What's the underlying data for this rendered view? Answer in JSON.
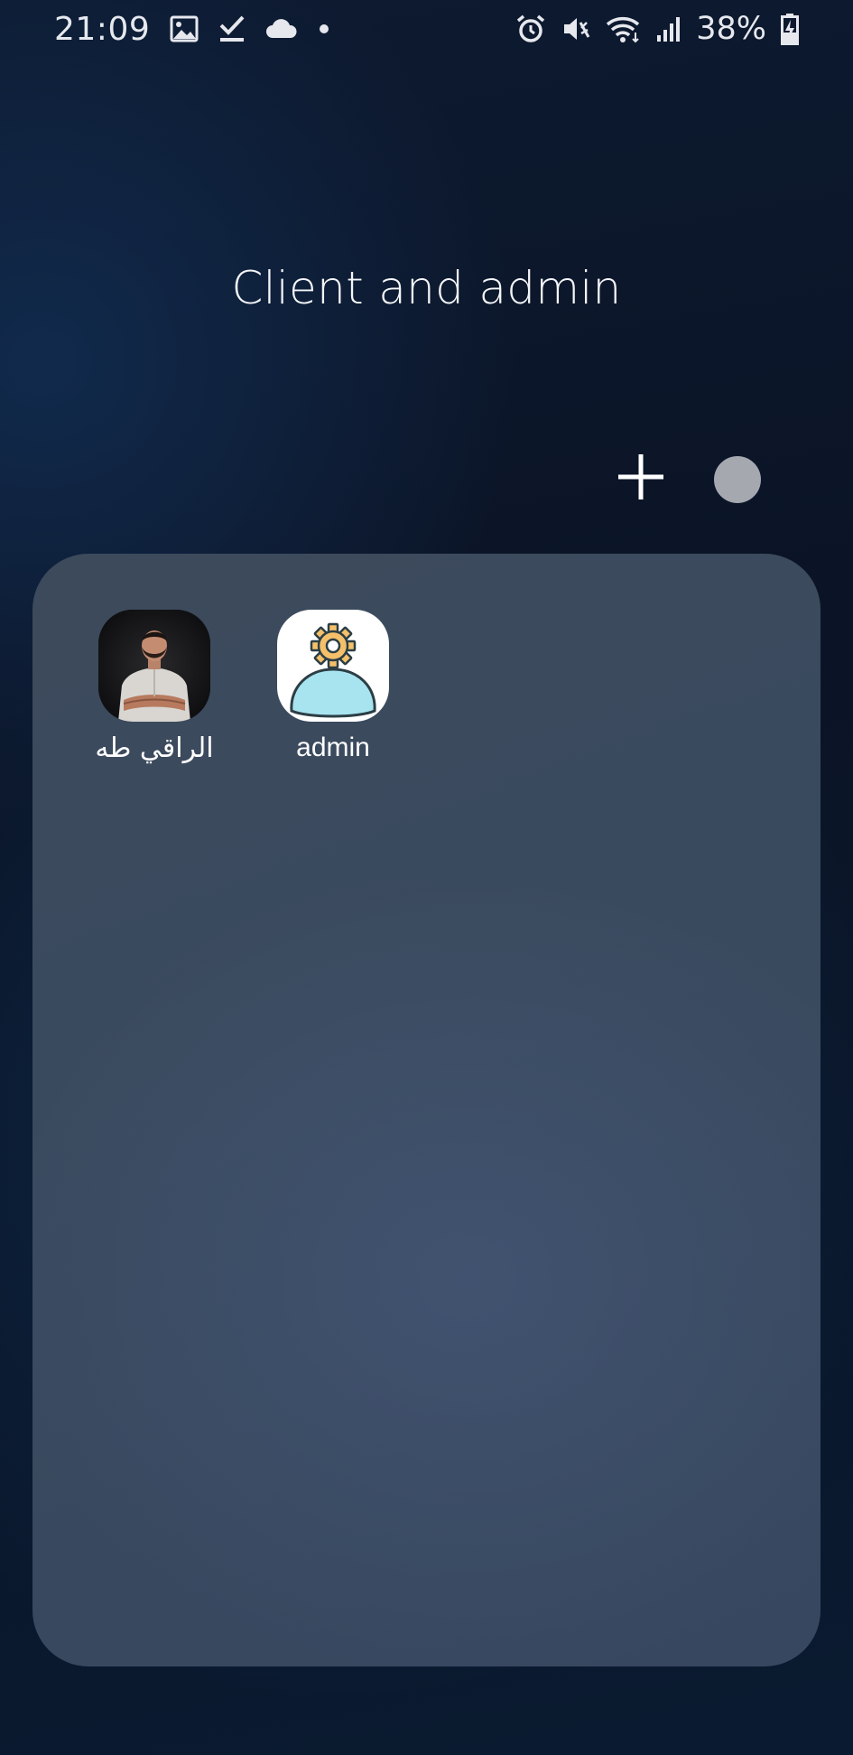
{
  "status_bar": {
    "time": "21:09",
    "left_icons": [
      "gallery-icon",
      "download-check-icon",
      "cloud-icon",
      "notification-dot-icon"
    ],
    "right_icons": [
      "alarm-icon",
      "vibrate-mute-icon",
      "wifi-icon",
      "signal-icon",
      "battery-charging-icon"
    ],
    "battery_percent": "38%"
  },
  "folder": {
    "title": "Client and admin",
    "add_icon": "plus-icon",
    "color_button_color": "#a6a8b0",
    "apps": [
      {
        "label": "الراقي طه",
        "icon": "profile-photo-icon"
      },
      {
        "label": "admin",
        "icon": "admin-user-gear-icon"
      }
    ]
  },
  "colors": {
    "panel": "#3c4a5c",
    "admin_gear": "#f5c06a",
    "admin_person": "#a8e4ef"
  }
}
